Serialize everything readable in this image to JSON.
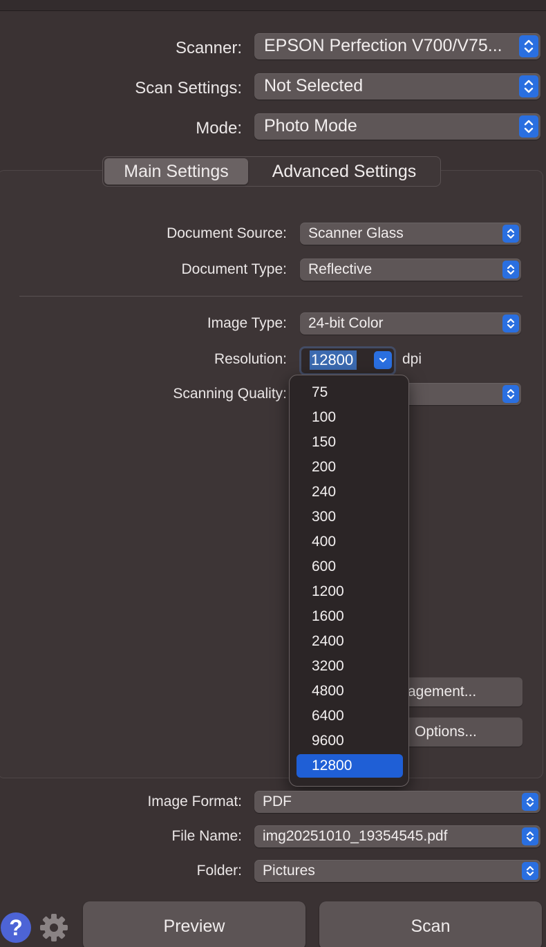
{
  "top_fields": [
    {
      "label": "Scanner:",
      "value": "EPSON Perfection V700/V75..."
    },
    {
      "label": "Scan Settings:",
      "value": "Not Selected"
    },
    {
      "label": "Mode:",
      "value": "Photo Mode"
    }
  ],
  "tabs": [
    {
      "label": "Main Settings",
      "active": true
    },
    {
      "label": "Advanced Settings",
      "active": false
    }
  ],
  "main": {
    "document_source": {
      "label": "Document Source:",
      "value": "Scanner Glass"
    },
    "document_type": {
      "label": "Document Type:",
      "value": "Reflective"
    },
    "image_type": {
      "label": "Image Type:",
      "value": "24-bit Color"
    },
    "resolution": {
      "label": "Resolution:",
      "value": "12800",
      "unit": "dpi"
    },
    "scanning_quality": {
      "label": "Scanning Quality:"
    },
    "color_management_button": "agement...",
    "options_button": "Options..."
  },
  "resolution_menu": {
    "options": [
      "75",
      "100",
      "150",
      "200",
      "240",
      "300",
      "400",
      "600",
      "1200",
      "1600",
      "2400",
      "3200",
      "4800",
      "6400",
      "9600",
      "12800"
    ],
    "selected": "12800"
  },
  "bottom_fields": [
    {
      "label": "Image Format:",
      "value": "PDF"
    },
    {
      "label": "File Name:",
      "value": "img20251010_19354545.pdf"
    },
    {
      "label": "Folder:",
      "value": "Pictures"
    }
  ],
  "footer": {
    "help_icon": "question-mark-icon",
    "settings_icon": "gear-icon",
    "preview_label": "Preview",
    "scan_label": "Scan"
  },
  "colors": {
    "accent": "#2a6fe0",
    "selection": "#1f5fd6",
    "background": "#3a3233"
  }
}
